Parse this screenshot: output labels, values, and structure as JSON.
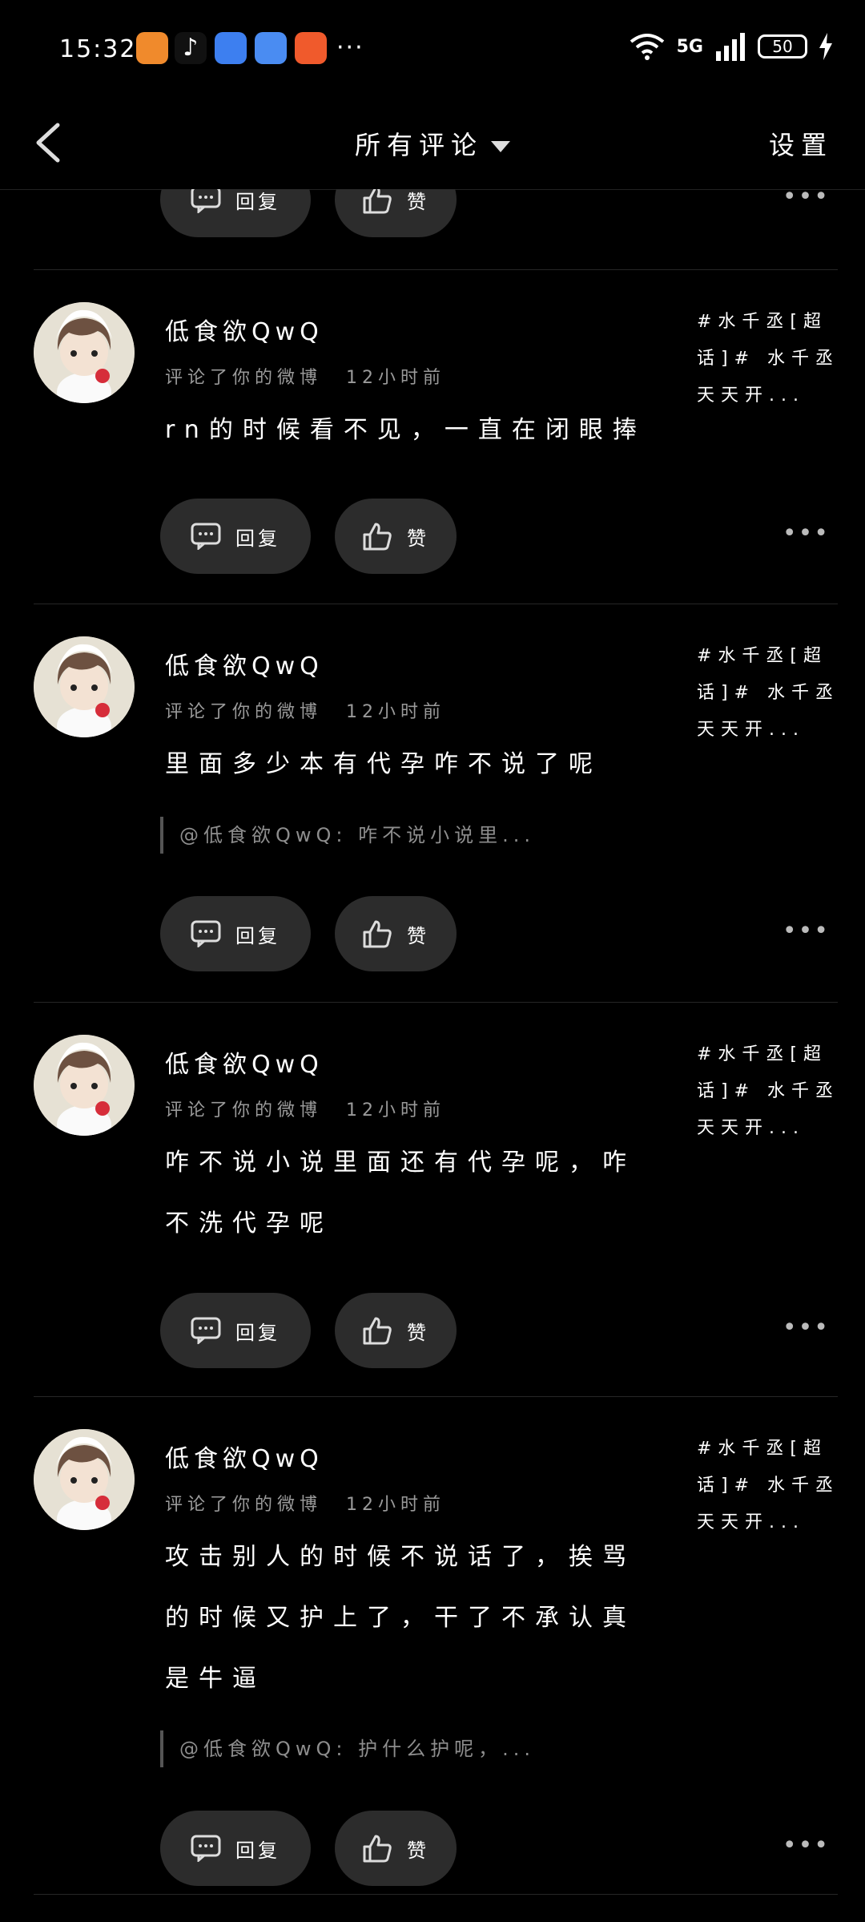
{
  "status": {
    "time": "15:32",
    "more": "···",
    "signal": "5G",
    "battery": "50"
  },
  "nav": {
    "title": "所有评论",
    "settings": "设置"
  },
  "actions": {
    "reply": "回复",
    "like": "赞",
    "more": "•••"
  },
  "comments": [
    {
      "author": "低食欲QwQ",
      "meta_action": "评论了你的微博",
      "time": "12小时前",
      "topic": "#水千丞[超话]# 水千丞天天开...",
      "lines": [
        "rn的时候看不见，一直在闭眼捧"
      ],
      "quote": ""
    },
    {
      "author": "低食欲QwQ",
      "meta_action": "评论了你的微博",
      "time": "12小时前",
      "topic": "#水千丞[超话]# 水千丞天天开...",
      "lines": [
        "里面多少本有代孕咋不说了呢"
      ],
      "quote": "@低食欲QwQ: 咋不说小说里..."
    },
    {
      "author": "低食欲QwQ",
      "meta_action": "评论了你的微博",
      "time": "12小时前",
      "topic": "#水千丞[超话]# 水千丞天天开...",
      "lines": [
        "咋不说小说里面还有代孕呢，咋",
        "不洗代孕呢"
      ],
      "quote": ""
    },
    {
      "author": "低食欲QwQ",
      "meta_action": "评论了你的微博",
      "time": "12小时前",
      "topic": "#水千丞[超话]# 水千丞天天开...",
      "lines": [
        "攻击别人的时候不说话了，挨骂",
        "的时候又护上了，干了不承认真",
        "是牛逼"
      ],
      "quote": "@低食欲QwQ: 护什么护呢，..."
    }
  ]
}
